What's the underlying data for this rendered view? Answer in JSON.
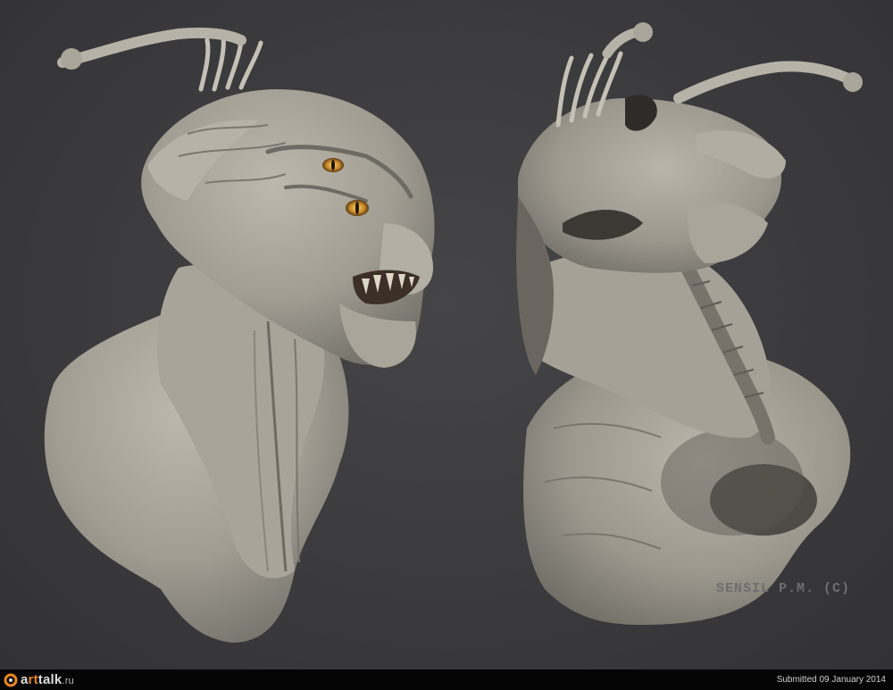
{
  "artwork": {
    "signature": "SENSIL P.M. (C)"
  },
  "footer": {
    "logo": {
      "prefix": "a",
      "accent": "rt",
      "suffix": "talk",
      "tld": ".ru"
    },
    "submitted_text": "Submitted 09 January 2014"
  },
  "colors": {
    "background": "#3b3b3d",
    "sculpt": "#a29e94",
    "sculpt_shadow": "#5c5953",
    "eye": "#c98a2a",
    "footer_bg": "#050505",
    "logo_accent": "#e8861f"
  }
}
